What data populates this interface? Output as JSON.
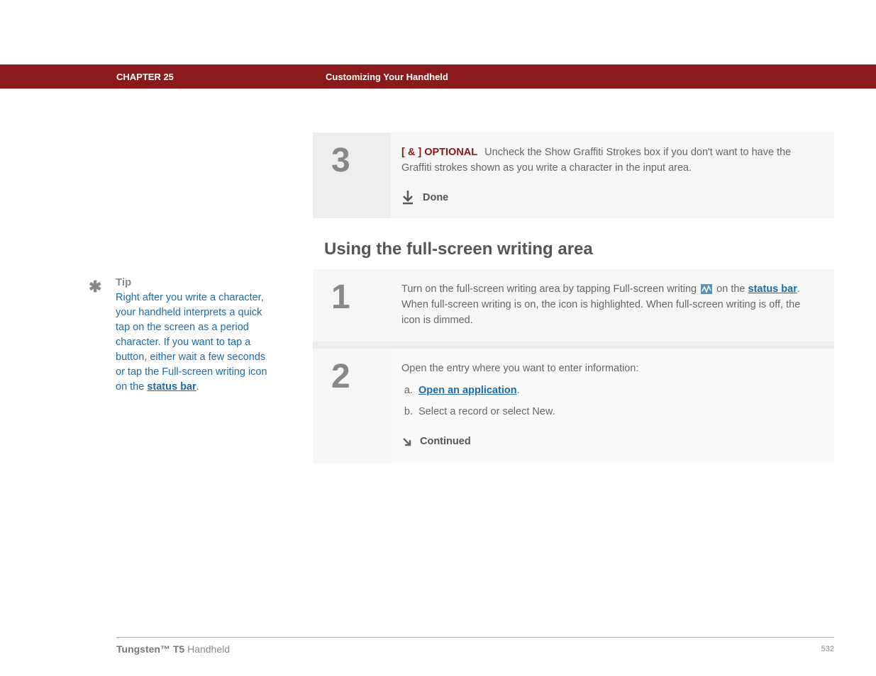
{
  "header": {
    "chapter": "CHAPTER 25",
    "title": "Customizing Your Handheld"
  },
  "sidebar": {
    "tip_label": "Tip",
    "tip_body_before": "Right after you write a character, your handheld interprets a quick tap on the screen as a period character. If you want to tap a button, either wait a few seconds or tap the Full-screen writing icon on the ",
    "tip_link": "status bar",
    "tip_body_after": "."
  },
  "step3": {
    "number": "3",
    "optional_label": "[ & ]  OPTIONAL",
    "text": "Uncheck the Show Graffiti Strokes box if you don't want to have the Graffiti strokes shown as you write a character in the input area.",
    "done": "Done"
  },
  "section_heading": "Using the full-screen writing area",
  "step1": {
    "number": "1",
    "text_before": "Turn on the full-screen writing area by tapping Full-screen writing ",
    "text_mid": " on the ",
    "link": "status bar",
    "text_after": ". When full-screen writing is on, the icon is highlighted. When full-screen writing is off, the icon is dimmed."
  },
  "step2": {
    "number": "2",
    "intro": "Open the entry where you want to enter information:",
    "item_a_link": "Open an application",
    "item_a_after": ".",
    "item_b": "Select a record or select New.",
    "continued": "Continued"
  },
  "footer": {
    "product_bold": "Tungsten™ T5",
    "product_rest": " Handheld",
    "page": "532"
  }
}
